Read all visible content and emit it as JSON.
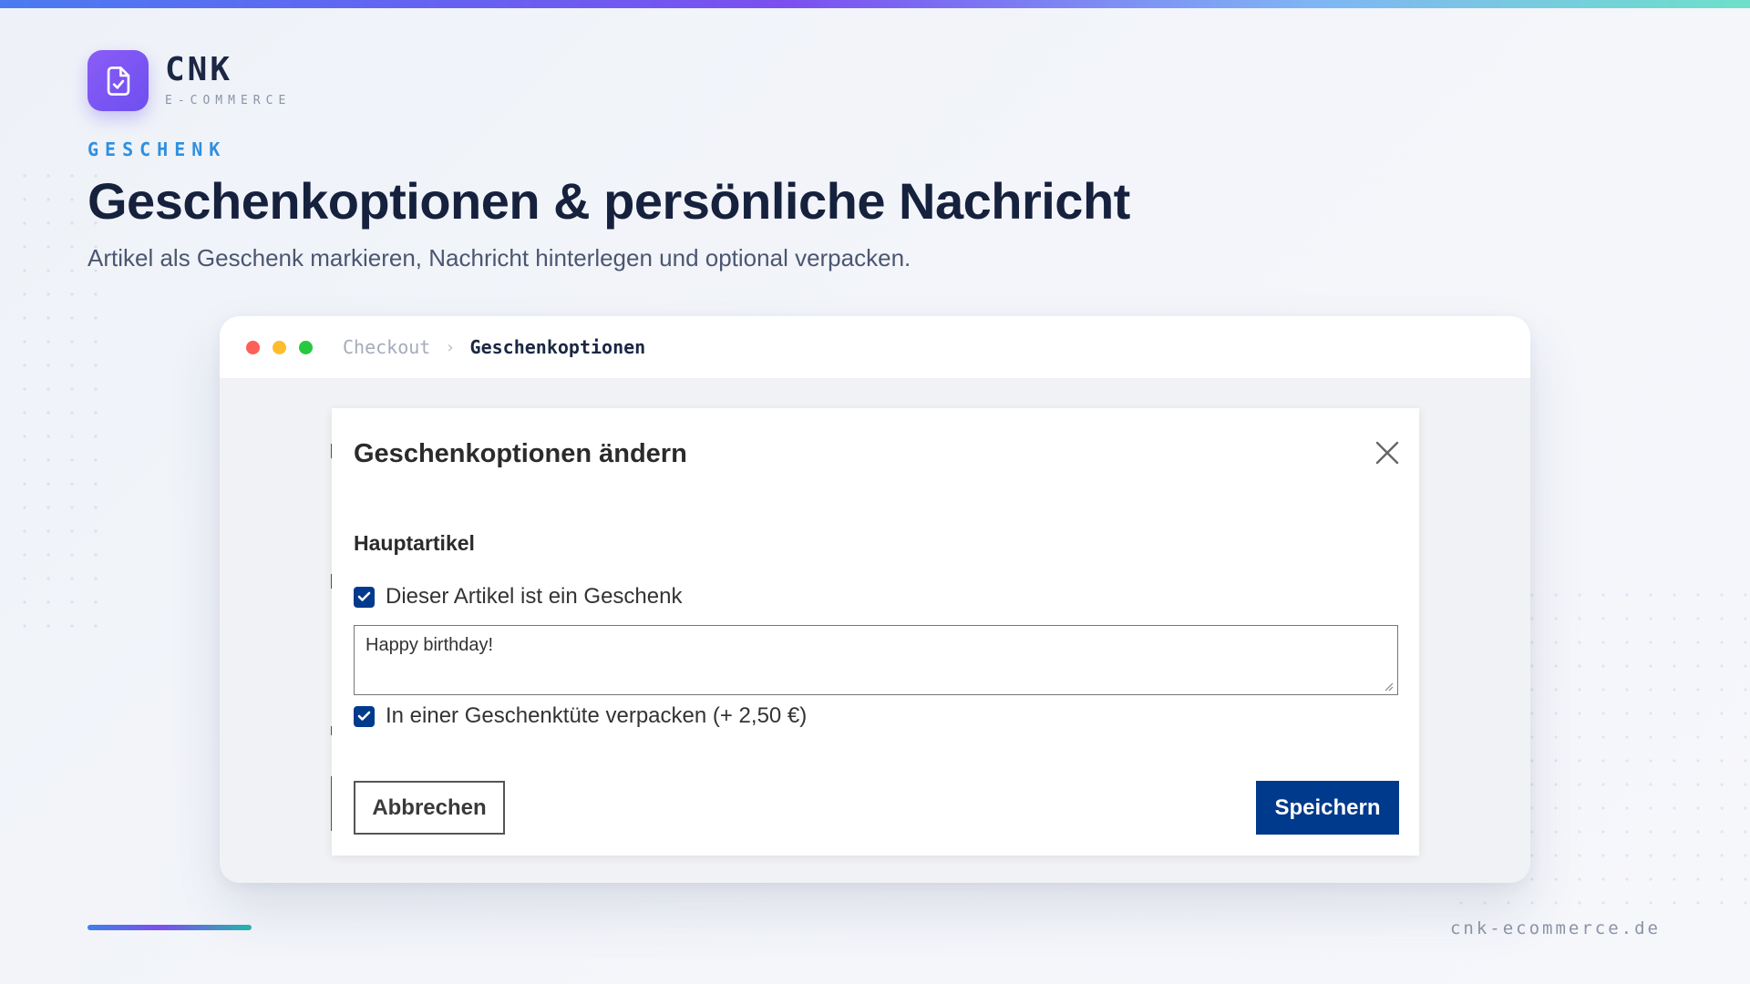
{
  "brand": {
    "name": "CNK",
    "tagline": "E-COMMERCE",
    "icon": "document-check-icon"
  },
  "hero": {
    "eyebrow": "GESCHENK",
    "title": "Geschenkoptionen & persönliche Nachricht",
    "subtitle": "Artikel als Geschenk markieren, Nachricht hinterlegen und optional verpacken."
  },
  "window": {
    "breadcrumb": {
      "previous": "Checkout",
      "separator": "›",
      "current": "Geschenkoptionen"
    }
  },
  "dialog": {
    "title": "Geschenkoptionen ändern",
    "close_icon": "close-icon",
    "section_title": "Hauptartikel",
    "gift_checkbox": {
      "label": "Dieser Artikel ist ein Geschenk",
      "checked": true
    },
    "message": {
      "value": "Happy birthday!"
    },
    "wrap_checkbox": {
      "label": "In einer Geschenktüte verpacken (+ 2,50 €)",
      "checked": true
    },
    "cancel_label": "Abbrechen",
    "save_label": "Speichern"
  },
  "footer": {
    "url": "cnk-ecommerce.de"
  },
  "colors": {
    "primary_button": "#003a8c",
    "brand_purple": "#7c55f2",
    "eyebrow_blue": "#2f8fe0"
  }
}
